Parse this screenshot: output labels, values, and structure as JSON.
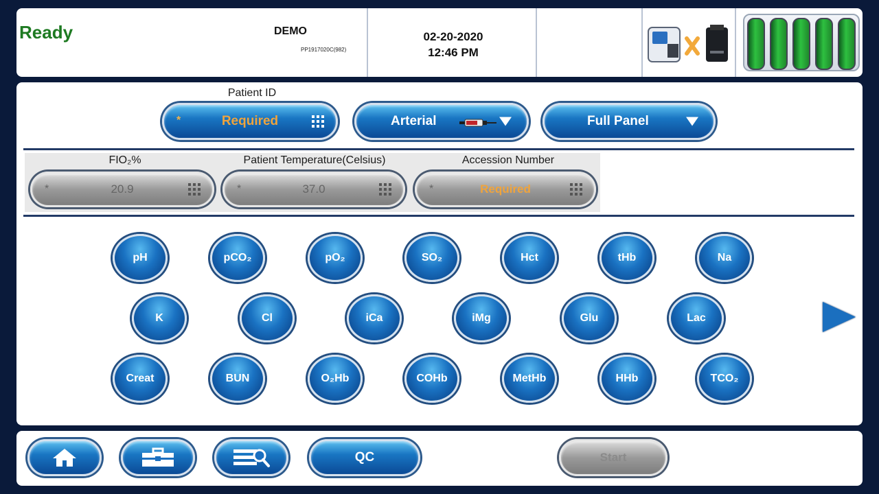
{
  "header": {
    "status": "Ready",
    "device_name": "DEMO",
    "serial": "PP1917020C(982)",
    "date": "02-20-2020",
    "time": "12:46 PM",
    "connection_icon": "analyzer-printer-disconnected-icon",
    "battery_cells": 5
  },
  "sample": {
    "patient_id_label": "Patient ID",
    "patient_id_placeholder": "Required",
    "sample_type": "Arterial",
    "panel": "Full Panel"
  },
  "fields": {
    "fio2_label": "FIO₂%",
    "fio2_value": "20.9",
    "temp_label": "Patient Temperature(Celsius)",
    "temp_value": "37.0",
    "accession_label": "Accession Number",
    "accession_placeholder": "Required"
  },
  "analytes": {
    "row1": [
      "pH",
      "pCO₂",
      "pO₂",
      "SO₂",
      "Hct",
      "tHb",
      "Na"
    ],
    "row2": [
      "K",
      "Cl",
      "iCa",
      "iMg",
      "Glu",
      "Lac"
    ],
    "row3": [
      "Creat",
      "BUN",
      "O₂Hb",
      "COHb",
      "MetHb",
      "HHb",
      "TCO₂"
    ]
  },
  "footer": {
    "home_icon": "home-icon",
    "toolbox_icon": "toolbox-icon",
    "search_list_icon": "search-list-icon",
    "qc_label": "QC",
    "start_label": "Start"
  },
  "colors": {
    "ready": "#1e7a22",
    "required": "#f0a43c",
    "accent_blue": "#1976c3",
    "frame": "#0a1a3a"
  }
}
